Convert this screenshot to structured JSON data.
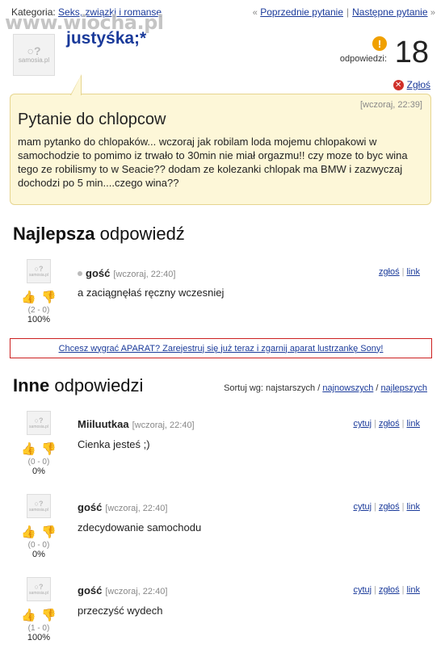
{
  "header": {
    "category_label": "Kategoria:",
    "category_link": "Seks, związki i romanse",
    "prev_label": "Poprzednie pytanie",
    "next_label": "Następne pytanie",
    "prev_arrow": "«",
    "next_arrow": "»",
    "separator": "|",
    "watermark": "www.wiocha.pl"
  },
  "avatar": {
    "bubbles": "○?",
    "text": "samosia.pl"
  },
  "question": {
    "author": "justyśka;*",
    "answers_label": "odpowiedzi:",
    "answers_count": "18",
    "badge": "!",
    "report_label": "Zgłoś",
    "time": "[wczoraj, 22:39]",
    "title": "Pytanie do chlopcow",
    "body": "mam pytanko do chlopaków... wczoraj jak robilam loda mojemu chlopakowi w samochodzie to pomimo iz trwało to 30min nie miał orgazmu!! czy moze to byc wina tego ze robilismy to w Seacie?? dodam ze kolezanki chlopak ma BMW i zazwyczaj dochodzi po 5 min....czego wina??"
  },
  "best": {
    "title_bold": "Najlepsza",
    "title_rest": " odpowiedź",
    "answer": {
      "author": "gość",
      "time": "[wczoraj, 22:40]",
      "text": "a zaciągnęłaś ręczny wczesniej",
      "votes": "(2 - 0)",
      "percent": "100%",
      "report": "zgłoś",
      "link": "link"
    }
  },
  "promo": {
    "text": "Chcesz wygrać APARAT? Zarejestruj się już teraz i zgarnij aparat lustrzankę Sony!"
  },
  "others": {
    "title_bold": "Inne",
    "title_rest": " odpowiedzi",
    "sort": {
      "label": "Sortuj wg: najstarszych /",
      "newest": "najnowszych",
      "slash": "/",
      "best": "najlepszych"
    },
    "answers": [
      {
        "author": "Miiluutkaa",
        "time": "[wczoraj, 22:40]",
        "text": "Cienka jesteś ;)",
        "votes": "(0 - 0)",
        "percent": "0%",
        "quote": "cytuj",
        "report": "zgłoś",
        "link": "link"
      },
      {
        "author": "gość",
        "time": "[wczoraj, 22:40]",
        "text": "zdecydowanie samochodu",
        "votes": "(0 - 0)",
        "percent": "0%",
        "quote": "cytuj",
        "report": "zgłoś",
        "link": "link"
      },
      {
        "author": "gość",
        "time": "[wczoraj, 22:40]",
        "text": "przeczyść wydech",
        "votes": "(1 - 0)",
        "percent": "100%",
        "quote": "cytuj",
        "report": "zgłoś",
        "link": "link"
      }
    ]
  },
  "icons": {
    "thumb_up": "thumb-up-icon",
    "thumb_down": "thumb-down-icon",
    "report": "close-icon",
    "info": "exclamation-icon"
  },
  "colors": {
    "link": "#1a3a9a",
    "accent_orange": "#f0a000",
    "question_bg": "#fdf7d8",
    "promo_border": "#cc2020"
  }
}
